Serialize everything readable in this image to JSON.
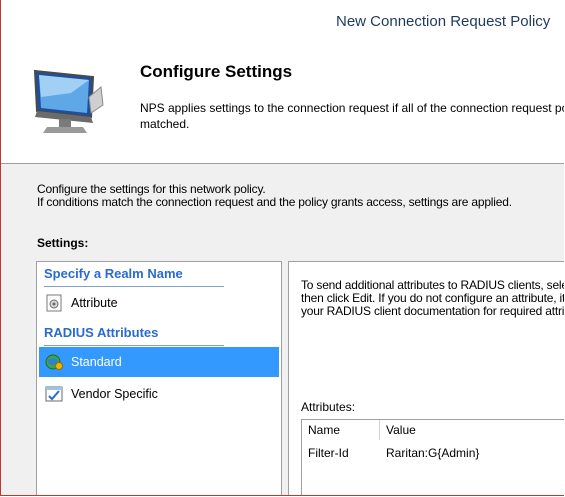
{
  "window": {
    "title": "New Connection Request Policy"
  },
  "header": {
    "heading": "Configure Settings",
    "description_line1": "NPS applies settings to the connection request if all of the connection request policy conditions are",
    "description_line2": "matched."
  },
  "intro": {
    "line1": "Configure the settings for this network policy.",
    "line2": "If conditions match the connection request and the policy grants access, settings are applied."
  },
  "settings": {
    "label": "Settings:",
    "groups": [
      {
        "header": "Specify a Realm Name",
        "items": [
          {
            "label": "Attribute",
            "icon": "attribute-icon"
          }
        ]
      },
      {
        "header": "RADIUS Attributes",
        "items": [
          {
            "label": "Standard",
            "icon": "standard-globe-icon",
            "selected": true
          },
          {
            "label": "Vendor Specific",
            "icon": "vendor-specific-icon"
          }
        ]
      }
    ]
  },
  "right": {
    "line1": "To send additional attributes to RADIUS clients, select a RADIUS Standard attribute, and",
    "line2": "then click Edit. If you do not configure an attribute, it is not sent to RADIUS clients. See",
    "line3": "your RADIUS client documentation for required attributes.",
    "attributes_label": "Attributes:",
    "table": {
      "columns": [
        "Name",
        "Value"
      ],
      "rows": [
        {
          "name": "Filter-Id",
          "value": "Raritan:G{Admin}"
        }
      ]
    }
  },
  "colors": {
    "selection": "#3399ff",
    "group_header": "#2a6ad3",
    "title": "#1e3a5f"
  }
}
